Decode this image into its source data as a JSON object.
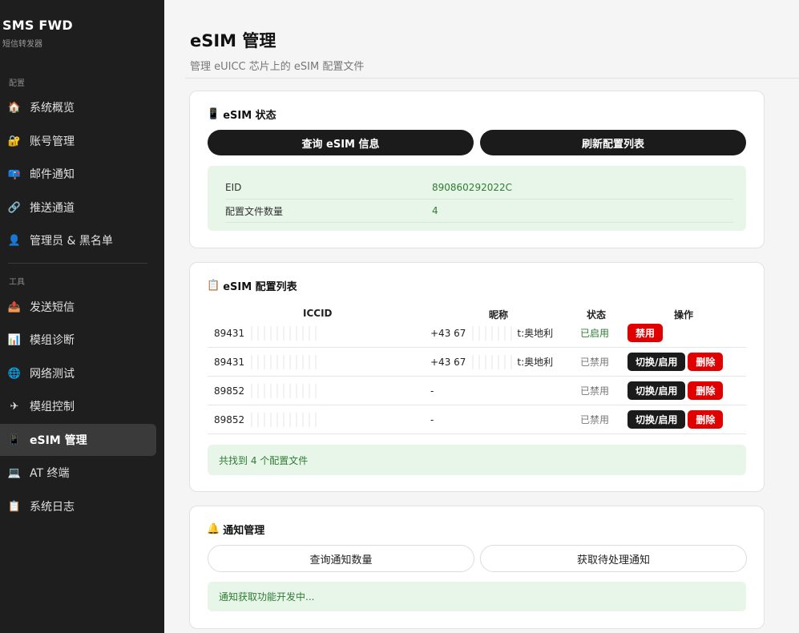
{
  "app": {
    "title": "SMS FWD",
    "subtitle": "短信转发器"
  },
  "sidebar": {
    "config_label": "配置",
    "tools_label": "工具",
    "config_items": [
      {
        "label": "系统概览",
        "icon": "house-icon"
      },
      {
        "label": "账号管理",
        "icon": "lock-icon"
      },
      {
        "label": "邮件通知",
        "icon": "mailbox-icon"
      },
      {
        "label": "推送通道",
        "icon": "link-icon"
      },
      {
        "label": "管理员 & 黑名单",
        "icon": "admin-user-icon"
      }
    ],
    "tool_items": [
      {
        "label": "发送短信",
        "icon": "outbox-icon"
      },
      {
        "label": "模组诊断",
        "icon": "bar-chart-icon"
      },
      {
        "label": "网络测试",
        "icon": "globe-icon"
      },
      {
        "label": "模组控制",
        "icon": "airplane-icon"
      },
      {
        "label": "eSIM 管理",
        "icon": "mobile-phone-icon",
        "active": true
      },
      {
        "label": "AT 终端",
        "icon": "laptop-icon"
      },
      {
        "label": "系统日志",
        "icon": "clipboard-icon"
      }
    ]
  },
  "page": {
    "title": "eSIM 管理",
    "subtitle": "管理 eUICC 芯片上的 eSIM 配置文件"
  },
  "status_card": {
    "title": "eSIM 状态",
    "query_button": "查询 eSIM 信息",
    "refresh_button": "刷新配置列表",
    "rows": [
      {
        "key": "EID",
        "value": "890860292022C"
      },
      {
        "key": "配置文件数量",
        "value": "4"
      }
    ]
  },
  "profiles_card": {
    "title": "eSIM 配置列表",
    "headers": {
      "iccid": "ICCID",
      "nickname": "昵称",
      "status": "状态",
      "actions": "操作"
    },
    "rows": [
      {
        "iccid": "89431",
        "nickname": "+43 67",
        "nickname_tail": "t:奥地利",
        "status": "已启用",
        "enabled": true,
        "actions": [
          "禁用"
        ]
      },
      {
        "iccid": "89431",
        "nickname": "+43 67",
        "nickname_tail": "t:奥地利",
        "status": "已禁用",
        "enabled": false,
        "actions": [
          "切换/启用",
          "删除"
        ]
      },
      {
        "iccid": "89852",
        "nickname": "-",
        "nickname_tail": "",
        "status": "已禁用",
        "enabled": false,
        "actions": [
          "切换/启用",
          "删除"
        ]
      },
      {
        "iccid": "89852",
        "nickname": "-",
        "nickname_tail": "",
        "status": "已禁用",
        "enabled": false,
        "actions": [
          "切换/启用",
          "删除"
        ]
      }
    ],
    "footer": "共找到 4 个配置文件"
  },
  "notify_card": {
    "title": "通知管理",
    "count_button": "查询通知数量",
    "pending_button": "获取待处理通知",
    "message": "通知获取功能开发中..."
  },
  "colors": {
    "sidebar_bg": "#1e1e1e",
    "accent_green": "#2e7d32",
    "info_bg": "#e8f5e9",
    "danger": "#e00000"
  }
}
